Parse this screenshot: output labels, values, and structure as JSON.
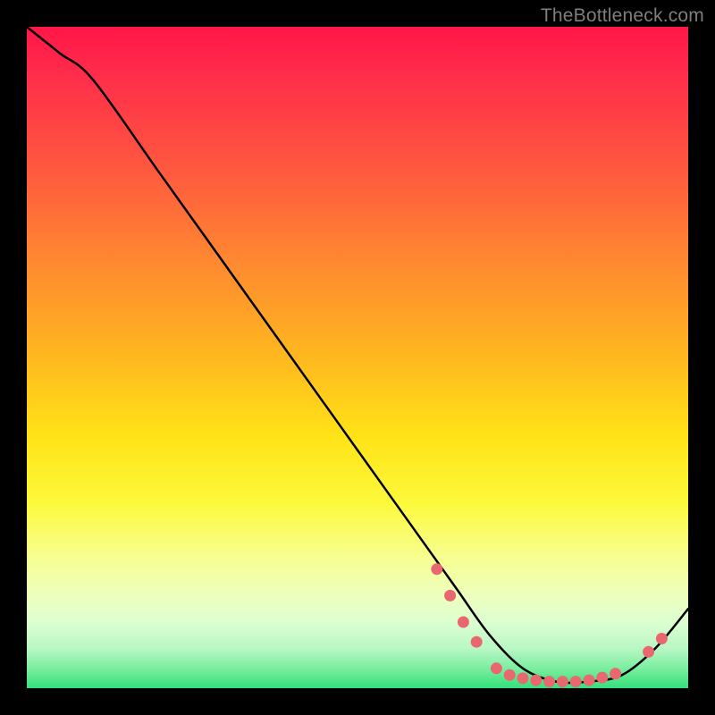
{
  "watermark": "TheBottleneck.com",
  "chart_data": {
    "type": "line",
    "title": "",
    "xlabel": "",
    "ylabel": "",
    "xlim": [
      0,
      100
    ],
    "ylim": [
      0,
      100
    ],
    "grid": false,
    "series": [
      {
        "name": "curve",
        "x": [
          0,
          5,
          10,
          20,
          30,
          40,
          50,
          60,
          65,
          70,
          75,
          80,
          85,
          90,
          95,
          100
        ],
        "y": [
          100,
          96,
          92,
          78,
          64,
          50,
          36,
          22,
          15,
          8,
          3,
          1,
          1,
          2,
          6,
          12
        ],
        "color": "#000000"
      }
    ],
    "markers": [
      {
        "x": 62,
        "y": 18,
        "color": "#e9686f"
      },
      {
        "x": 64,
        "y": 14,
        "color": "#e9686f"
      },
      {
        "x": 66,
        "y": 10,
        "color": "#e9686f"
      },
      {
        "x": 68,
        "y": 7,
        "color": "#e9686f"
      },
      {
        "x": 71,
        "y": 3,
        "color": "#e9686f"
      },
      {
        "x": 73,
        "y": 2,
        "color": "#e9686f"
      },
      {
        "x": 75,
        "y": 1.5,
        "color": "#e9686f"
      },
      {
        "x": 77,
        "y": 1.2,
        "color": "#e9686f"
      },
      {
        "x": 79,
        "y": 1.0,
        "color": "#e9686f"
      },
      {
        "x": 81,
        "y": 1.0,
        "color": "#e9686f"
      },
      {
        "x": 83,
        "y": 1.0,
        "color": "#e9686f"
      },
      {
        "x": 85,
        "y": 1.2,
        "color": "#e9686f"
      },
      {
        "x": 87,
        "y": 1.6,
        "color": "#e9686f"
      },
      {
        "x": 89,
        "y": 2.2,
        "color": "#e9686f"
      },
      {
        "x": 94,
        "y": 5.5,
        "color": "#e9686f"
      },
      {
        "x": 96,
        "y": 7.5,
        "color": "#e9686f"
      }
    ]
  }
}
